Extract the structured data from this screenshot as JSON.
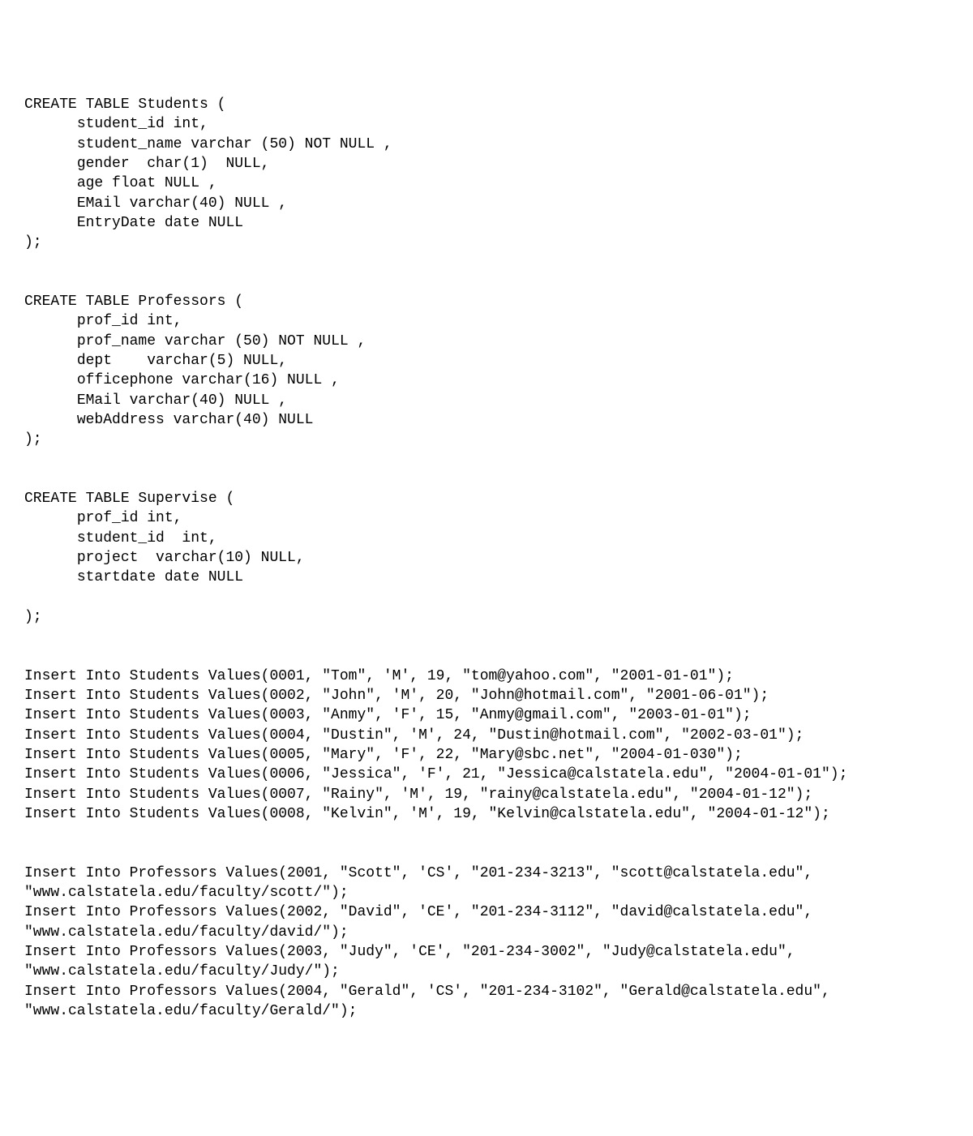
{
  "sql": {
    "create_students": "CREATE TABLE Students (\n      student_id int,\n      student_name varchar (50) NOT NULL ,\n      gender  char(1)  NULL,\n      age float NULL ,\n      EMail varchar(40) NULL ,\n      EntryDate date NULL\n);",
    "create_professors": "CREATE TABLE Professors (\n      prof_id int,\n      prof_name varchar (50) NOT NULL ,\n      dept    varchar(5) NULL,\n      officephone varchar(16) NULL ,\n      EMail varchar(40) NULL ,\n      webAddress varchar(40) NULL\n);",
    "create_supervise": "CREATE TABLE Supervise (\n      prof_id int,\n      student_id  int,\n      project  varchar(10) NULL,\n      startdate date NULL\n\n);",
    "insert_students": "Insert Into Students Values(0001, \"Tom\", 'M', 19, \"tom@yahoo.com\", \"2001-01-01\");\nInsert Into Students Values(0002, \"John\", 'M', 20, \"John@hotmail.com\", \"2001-06-01\");\nInsert Into Students Values(0003, \"Anmy\", 'F', 15, \"Anmy@gmail.com\", \"2003-01-01\");\nInsert Into Students Values(0004, \"Dustin\", 'M', 24, \"Dustin@hotmail.com\", \"2002-03-01\");\nInsert Into Students Values(0005, \"Mary\", 'F', 22, \"Mary@sbc.net\", \"2004-01-030\");\nInsert Into Students Values(0006, \"Jessica\", 'F', 21, \"Jessica@calstatela.edu\", \"2004-01-01\");\nInsert Into Students Values(0007, \"Rainy\", 'M', 19, \"rainy@calstatela.edu\", \"2004-01-12\");\nInsert Into Students Values(0008, \"Kelvin\", 'M', 19, \"Kelvin@calstatela.edu\", \"2004-01-12\");",
    "insert_professors": "Insert Into Professors Values(2001, \"Scott\", 'CS', \"201-234-3213\", \"scott@calstatela.edu\", \"www.calstatela.edu/faculty/scott/\");\nInsert Into Professors Values(2002, \"David\", 'CE', \"201-234-3112\", \"david@calstatela.edu\", \"www.calstatela.edu/faculty/david/\");\nInsert Into Professors Values(2003, \"Judy\", 'CE', \"201-234-3002\", \"Judy@calstatela.edu\", \"www.calstatela.edu/faculty/Judy/\");\nInsert Into Professors Values(2004, \"Gerald\", 'CS', \"201-234-3102\", \"Gerald@calstatela.edu\", \"www.calstatela.edu/faculty/Gerald/\");"
  }
}
